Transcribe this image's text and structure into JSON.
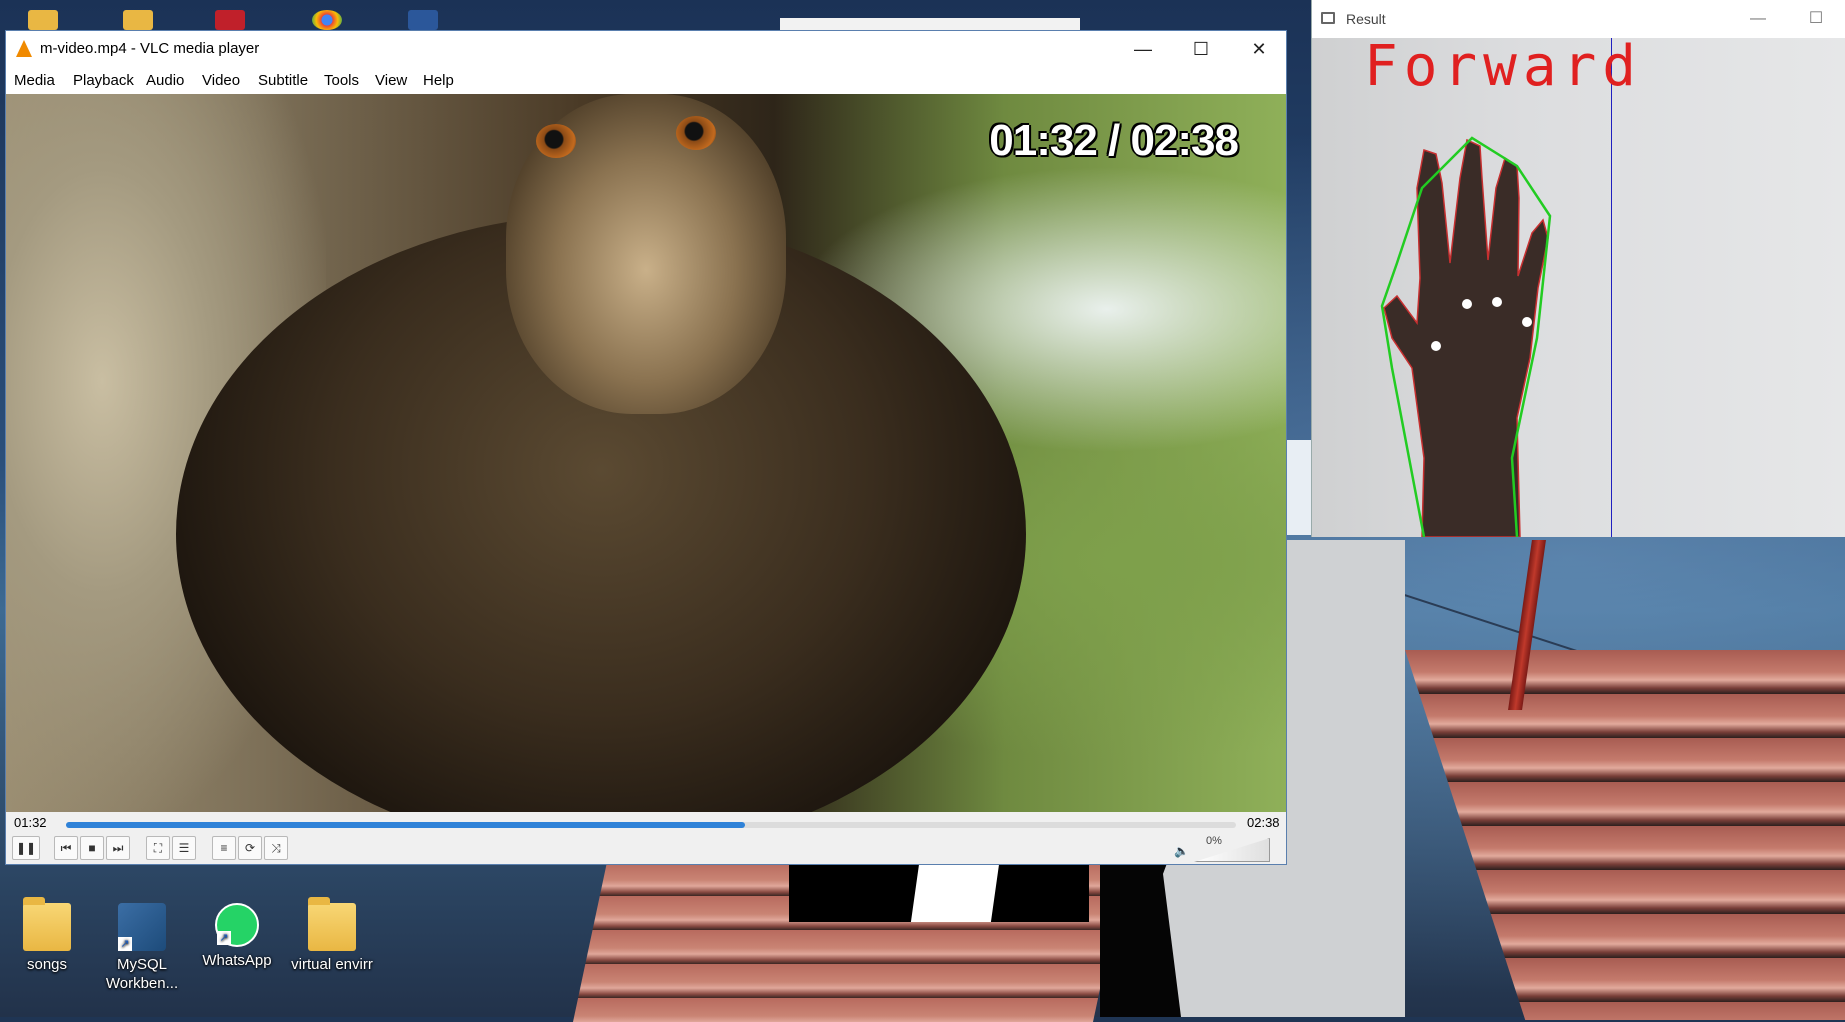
{
  "vlc": {
    "window_title": "m-video.mp4 - VLC media player",
    "menu": [
      "Media",
      "Playback",
      "Audio",
      "Video",
      "Subtitle",
      "Tools",
      "View",
      "Help"
    ],
    "osd_time": "01:32 / 02:38",
    "elapsed": "01:32",
    "total": "02:38",
    "progress_fraction": 0.58,
    "volume": "0%",
    "window_buttons": {
      "minimize": "—",
      "maximize": "☐",
      "close": "✕"
    },
    "controls": [
      {
        "name": "pause-button",
        "glyph": "❚❚"
      },
      {
        "name": "previous-button",
        "glyph": "⏮"
      },
      {
        "name": "stop-button",
        "glyph": "■"
      },
      {
        "name": "next-button",
        "glyph": "⏭"
      },
      {
        "name": "fullscreen-button",
        "glyph": "⛶"
      },
      {
        "name": "extended-settings-button",
        "glyph": "☰"
      },
      {
        "name": "playlist-button",
        "glyph": "≡"
      },
      {
        "name": "loop-button",
        "glyph": "⟳"
      },
      {
        "name": "shuffle-button",
        "glyph": "⤨"
      }
    ]
  },
  "result": {
    "window_title": "Result",
    "gesture": "Forward",
    "window_buttons": {
      "minimize": "—",
      "maximize": "☐"
    }
  },
  "desktop": {
    "icons": [
      {
        "label": "songs",
        "kind": "folder-icon"
      },
      {
        "label": "MySQL Workben...",
        "kind": "mysql-workbench-icon"
      },
      {
        "label": "WhatsApp",
        "kind": "whatsapp-icon"
      },
      {
        "label": "virtual envirr",
        "kind": "folder-icon"
      }
    ]
  },
  "colors": {
    "vlc_accent": "#f08a00",
    "seek_fill": "#2f82d8",
    "gesture_text": "#e02020",
    "contour": "#22cc22"
  }
}
